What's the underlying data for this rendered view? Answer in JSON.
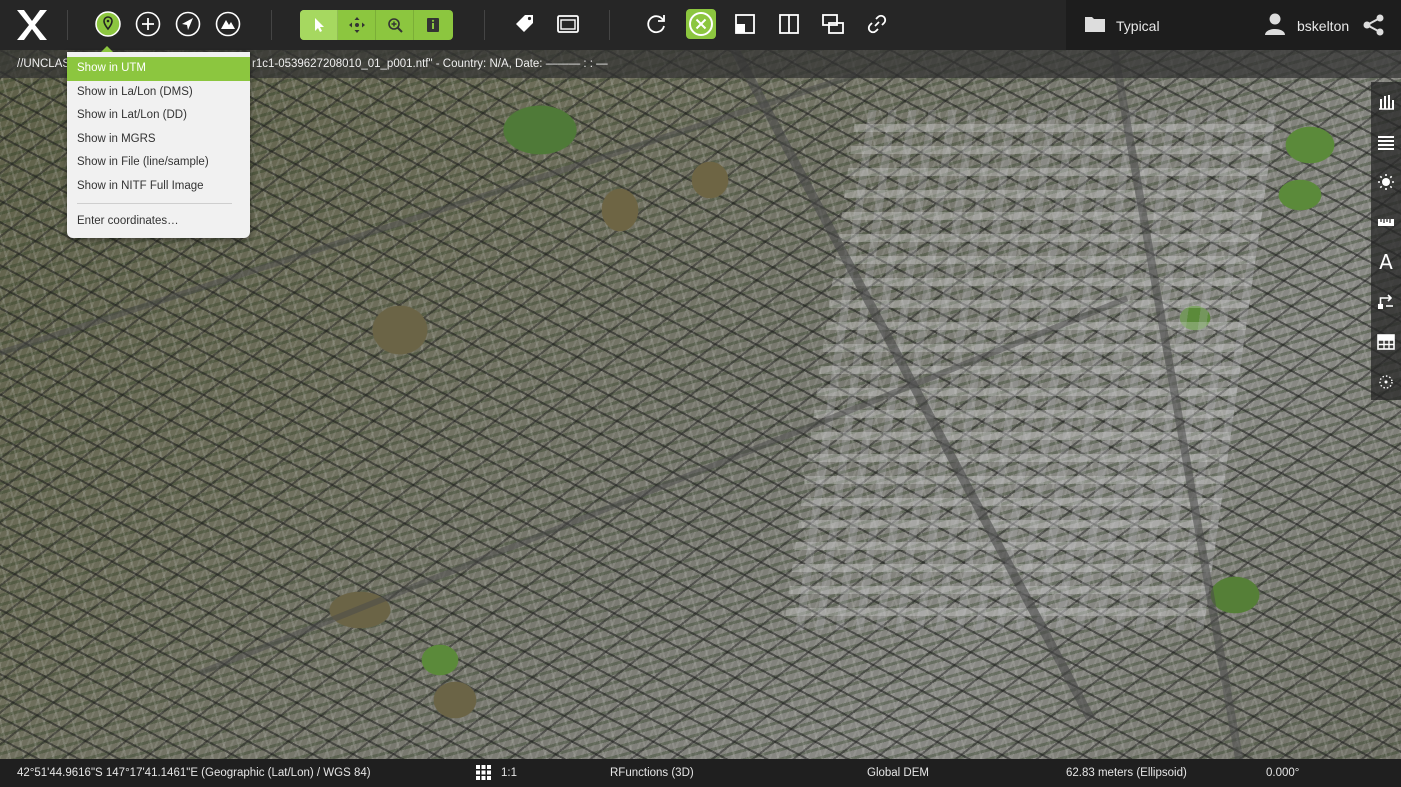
{
  "app": {
    "logo_icon": "x-logo",
    "accent_color": "#8cc63f"
  },
  "toolbar": {
    "left_buttons": [
      "location-pin-icon",
      "zoom-in-icon",
      "navigate-arrow-icon",
      "terrain-icon"
    ],
    "tool_group": [
      "pointer-icon",
      "pan-icon",
      "zoom-region-icon",
      "info-icon"
    ],
    "mid_buttons": [
      "tag-icon",
      "screen-icon"
    ],
    "view_buttons": [
      "rotate-icon",
      "close-circle-icon",
      "single-pane-icon",
      "split-vertical-icon",
      "split-horizontal-icon",
      "link-icon"
    ]
  },
  "profile": {
    "folder_label": "Typical",
    "username": "bskelton"
  },
  "banner": {
    "left_text": "//UNCLAS",
    "right_text": "r1c1-0539627208010_01_p001.ntf\" - Country: N/A, Date: ——— : : —"
  },
  "location_menu": {
    "items": [
      {
        "label": "Show in UTM",
        "selected": true
      },
      {
        "label": "Show in La/Lon (DMS)",
        "selected": false
      },
      {
        "label": "Show in Lat/Lon (DD)",
        "selected": false
      },
      {
        "label": "Show in MGRS",
        "selected": false
      },
      {
        "label": "Show in File (line/sample)",
        "selected": false
      },
      {
        "label": "Show in NITF Full Image",
        "selected": false
      }
    ],
    "footer_item": "Enter coordinates…"
  },
  "right_tools": [
    "histogram-icon",
    "layers-icon",
    "brightness-icon",
    "ruler-icon",
    "text-icon",
    "flow-icon",
    "table-icon",
    "dotted-circle-icon"
  ],
  "right_tools_text": {
    "text_tool": "A"
  },
  "status": {
    "coordinates": "42°51'44.9616\"S 147°17'41.1461\"E (Geographic (Lat/Lon) / WGS 84)",
    "scale": "1:1",
    "projection": "RFunctions (3D)",
    "dem": "Global DEM",
    "elevation": "62.83 meters (Ellipsoid)",
    "rotation": "0.000°"
  }
}
